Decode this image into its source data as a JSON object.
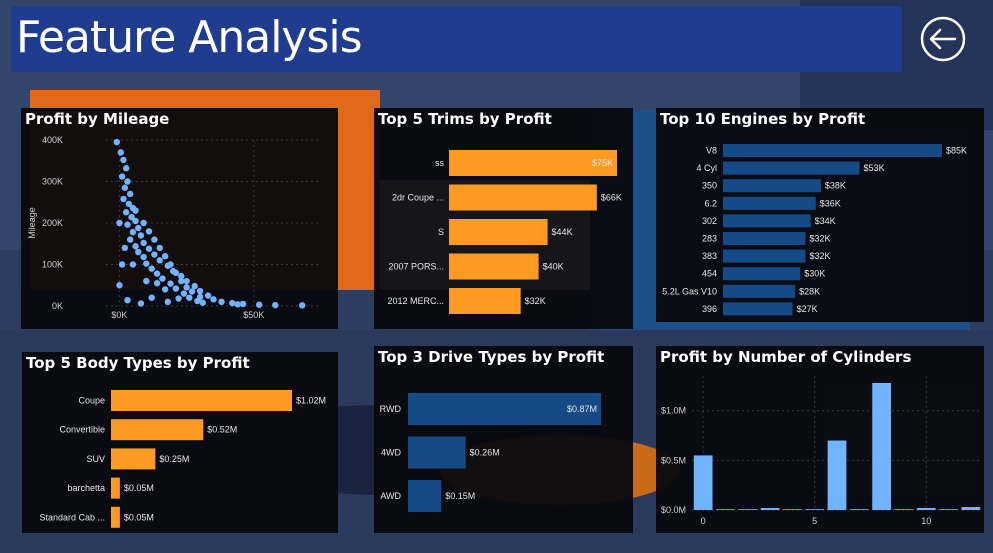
{
  "header": {
    "title": "Feature Analysis",
    "back_icon": "back-arrow-icon"
  },
  "colors": {
    "orange": "#fd9a22",
    "navy": "#164a86",
    "light_blue": "#72b3ff",
    "title_bar": "#1f3c8f"
  },
  "panels": {
    "mileage": {
      "title": "Profit by Mileage"
    },
    "trims": {
      "title": "Top 5 Trims by Profit"
    },
    "engines": {
      "title": "Top 10 Engines by Profit"
    },
    "body": {
      "title": "Top 5 Body Types by Profit"
    },
    "drive": {
      "title": "Top 3 Drive Types by Profit"
    },
    "cyl": {
      "title": "Profit by Number of Cylinders"
    }
  },
  "chart_data": [
    {
      "id": "mileage",
      "type": "scatter",
      "title": "Profit by Mileage",
      "xlabel": "",
      "ylabel": "Mileage",
      "xlim": [
        -5000,
        75000
      ],
      "ylim": [
        0,
        400000
      ],
      "xticks": [
        {
          "v": 0,
          "label": "$0K"
        },
        {
          "v": 50000,
          "label": "$50K"
        }
      ],
      "yticks": [
        {
          "v": 0,
          "label": "0K"
        },
        {
          "v": 100000,
          "label": "100K"
        },
        {
          "v": 200000,
          "label": "200K"
        },
        {
          "v": 300000,
          "label": "300K"
        },
        {
          "v": 400000,
          "label": "400K"
        }
      ],
      "points": [
        [
          -1000,
          395000
        ],
        [
          500,
          370000
        ],
        [
          1500,
          352000
        ],
        [
          2500,
          332000
        ],
        [
          1000,
          312000
        ],
        [
          3000,
          300000
        ],
        [
          2000,
          285000
        ],
        [
          4000,
          270000
        ],
        [
          1500,
          258000
        ],
        [
          3500,
          246000
        ],
        [
          5000,
          236000
        ],
        [
          2500,
          226000
        ],
        [
          4500,
          214000
        ],
        [
          6000,
          205000
        ],
        [
          3000,
          196000
        ],
        [
          7000,
          188000
        ],
        [
          5000,
          178000
        ],
        [
          8000,
          170000
        ],
        [
          4000,
          160000
        ],
        [
          9000,
          152000
        ],
        [
          6000,
          144000
        ],
        [
          11000,
          138000
        ],
        [
          7000,
          130000
        ],
        [
          13000,
          124000
        ],
        [
          9000,
          118000
        ],
        [
          15000,
          110000
        ],
        [
          10000,
          102000
        ],
        [
          18000,
          97000
        ],
        [
          12000,
          90000
        ],
        [
          20000,
          84000
        ],
        [
          14000,
          78000
        ],
        [
          23000,
          72000
        ],
        [
          16000,
          66000
        ],
        [
          25000,
          60000
        ],
        [
          19000,
          54000
        ],
        [
          28000,
          48000
        ],
        [
          21000,
          42000
        ],
        [
          30000,
          36000
        ],
        [
          24000,
          30000
        ],
        [
          33000,
          25000
        ],
        [
          26000,
          20000
        ],
        [
          35000,
          16000
        ],
        [
          29000,
          12000
        ],
        [
          38000,
          10000
        ],
        [
          31000,
          8000
        ],
        [
          42000,
          7000
        ],
        [
          44000,
          4000
        ],
        [
          17000,
          40000
        ],
        [
          12000,
          20000
        ],
        [
          8000,
          6000
        ],
        [
          3000,
          14000
        ],
        [
          14000,
          55000
        ],
        [
          30000,
          22000
        ],
        [
          46000,
          5000
        ],
        [
          52000,
          3000
        ],
        [
          58000,
          2000
        ],
        [
          68000,
          1500
        ],
        [
          6000,
          230000
        ],
        [
          9000,
          200000
        ],
        [
          11000,
          180000
        ],
        [
          13000,
          160000
        ],
        [
          15000,
          140000
        ],
        [
          17000,
          120000
        ],
        [
          19000,
          100000
        ],
        [
          21000,
          80000
        ],
        [
          23000,
          60000
        ],
        [
          25000,
          45000
        ],
        [
          27000,
          35000
        ],
        [
          22000,
          18000
        ],
        [
          18000,
          10000
        ],
        [
          10000,
          60000
        ],
        [
          5000,
          100000
        ],
        [
          2000,
          140000
        ],
        [
          0,
          200000
        ],
        [
          1000,
          100000
        ],
        [
          0,
          50000
        ]
      ]
    },
    {
      "id": "trims",
      "type": "bar",
      "title": "Top 5 Trims by Profit",
      "categories": [
        "ss",
        "2dr Coupe ...",
        "S",
        "2007 PORS...",
        "2012 MERC..."
      ],
      "values": [
        75,
        66,
        44,
        40,
        32
      ],
      "value_labels": [
        "$75K",
        "$66K",
        "$44K",
        "$40K",
        "$32K"
      ],
      "max": 75
    },
    {
      "id": "engines",
      "type": "bar",
      "title": "Top 10 Engines by Profit",
      "categories": [
        "V8",
        "4 Cyl",
        "350",
        "6.2",
        "302",
        "283",
        "383",
        "454",
        "5.2L Gas V10",
        "396"
      ],
      "values": [
        85,
        53,
        38,
        36,
        34,
        32,
        32,
        30,
        28,
        27
      ],
      "value_labels": [
        "$85K",
        "$53K",
        "$38K",
        "$36K",
        "$34K",
        "$32K",
        "$32K",
        "$30K",
        "$28K",
        "$27K"
      ],
      "max": 85
    },
    {
      "id": "body",
      "type": "bar",
      "title": "Top 5 Body Types by Profit",
      "categories": [
        "Coupe",
        "Convertible",
        "SUV",
        "barchetta",
        "Standard Cab ..."
      ],
      "values": [
        1.02,
        0.52,
        0.25,
        0.05,
        0.05
      ],
      "value_labels": [
        "$1.02M",
        "$0.52M",
        "$0.25M",
        "$0.05M",
        "$0.05M"
      ],
      "max": 1.02
    },
    {
      "id": "drive",
      "type": "bar",
      "title": "Top 3 Drive Types by Profit",
      "categories": [
        "RWD",
        "4WD",
        "AWD"
      ],
      "values": [
        0.87,
        0.26,
        0.15
      ],
      "value_labels": [
        "$0.87M",
        "$0.26M",
        "$0.15M"
      ],
      "max": 0.87
    },
    {
      "id": "cyl",
      "type": "bar",
      "title": "Profit by Number of Cylinders",
      "x": [
        0,
        1,
        2,
        3,
        4,
        5,
        6,
        7,
        8,
        9,
        10,
        11,
        12
      ],
      "values": [
        0.55,
        0.0,
        0.0,
        0.02,
        0.0,
        0.0,
        0.7,
        0.0,
        1.28,
        0.0,
        0.02,
        0.0,
        0.03
      ],
      "ylim": [
        0,
        1.35
      ],
      "yticks": [
        {
          "v": 0,
          "label": "$0.0M"
        },
        {
          "v": 0.5,
          "label": "$0.5M"
        },
        {
          "v": 1.0,
          "label": "$1.0M"
        }
      ],
      "xticks": [
        {
          "v": 0,
          "label": "0"
        },
        {
          "v": 5,
          "label": "5"
        },
        {
          "v": 10,
          "label": "10"
        }
      ]
    }
  ]
}
